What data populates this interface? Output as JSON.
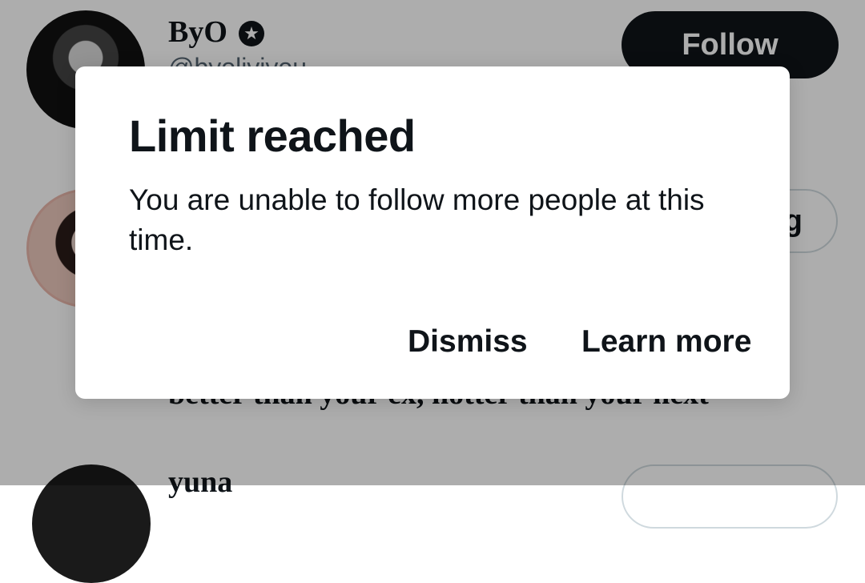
{
  "list": {
    "users": [
      {
        "name": "ByO",
        "handle": "@byolivivou",
        "button": "Follow"
      },
      {
        "name": "",
        "handle": "",
        "button": "g"
      },
      {
        "name": "yuna",
        "handle": "",
        "button": ""
      }
    ],
    "bio_snippet": "better than your ex, hotter than your next"
  },
  "dialog": {
    "title": "Limit reached",
    "body": "You are unable to follow more people at this time.",
    "dismiss_label": "Dismiss",
    "learn_more_label": "Learn more"
  },
  "icons": {
    "verified": "star-badge-icon"
  },
  "colors": {
    "primary_text": "#0f1419",
    "secondary_text": "#536471",
    "border": "#cfd9de",
    "scrim": "rgba(0,0,0,0.32)"
  }
}
